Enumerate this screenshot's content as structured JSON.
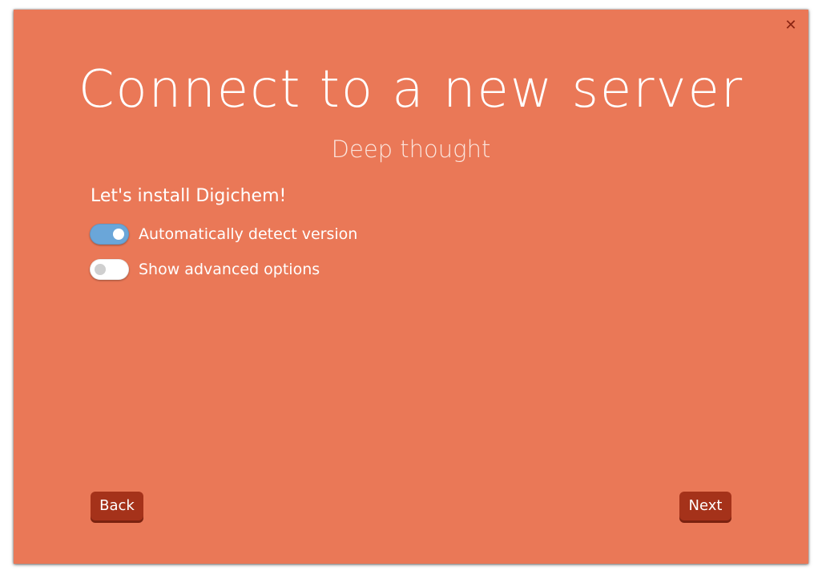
{
  "dialog": {
    "title": "Connect to a new server",
    "subtitle": "Deep thought",
    "close_symbol": "✕",
    "section_heading": "Let's install Digichem!",
    "options": [
      {
        "label": "Automatically detect version",
        "checked": true
      },
      {
        "label": "Show advanced options",
        "checked": false
      }
    ],
    "back_label": "Back",
    "next_label": "Next"
  },
  "colors": {
    "background": "#ea7857",
    "button": "#a5321a",
    "toggle_on": "#6aa6d9",
    "toggle_off": "#ffffff",
    "text": "#ffffff"
  },
  "icons": {
    "close": "close-icon"
  }
}
